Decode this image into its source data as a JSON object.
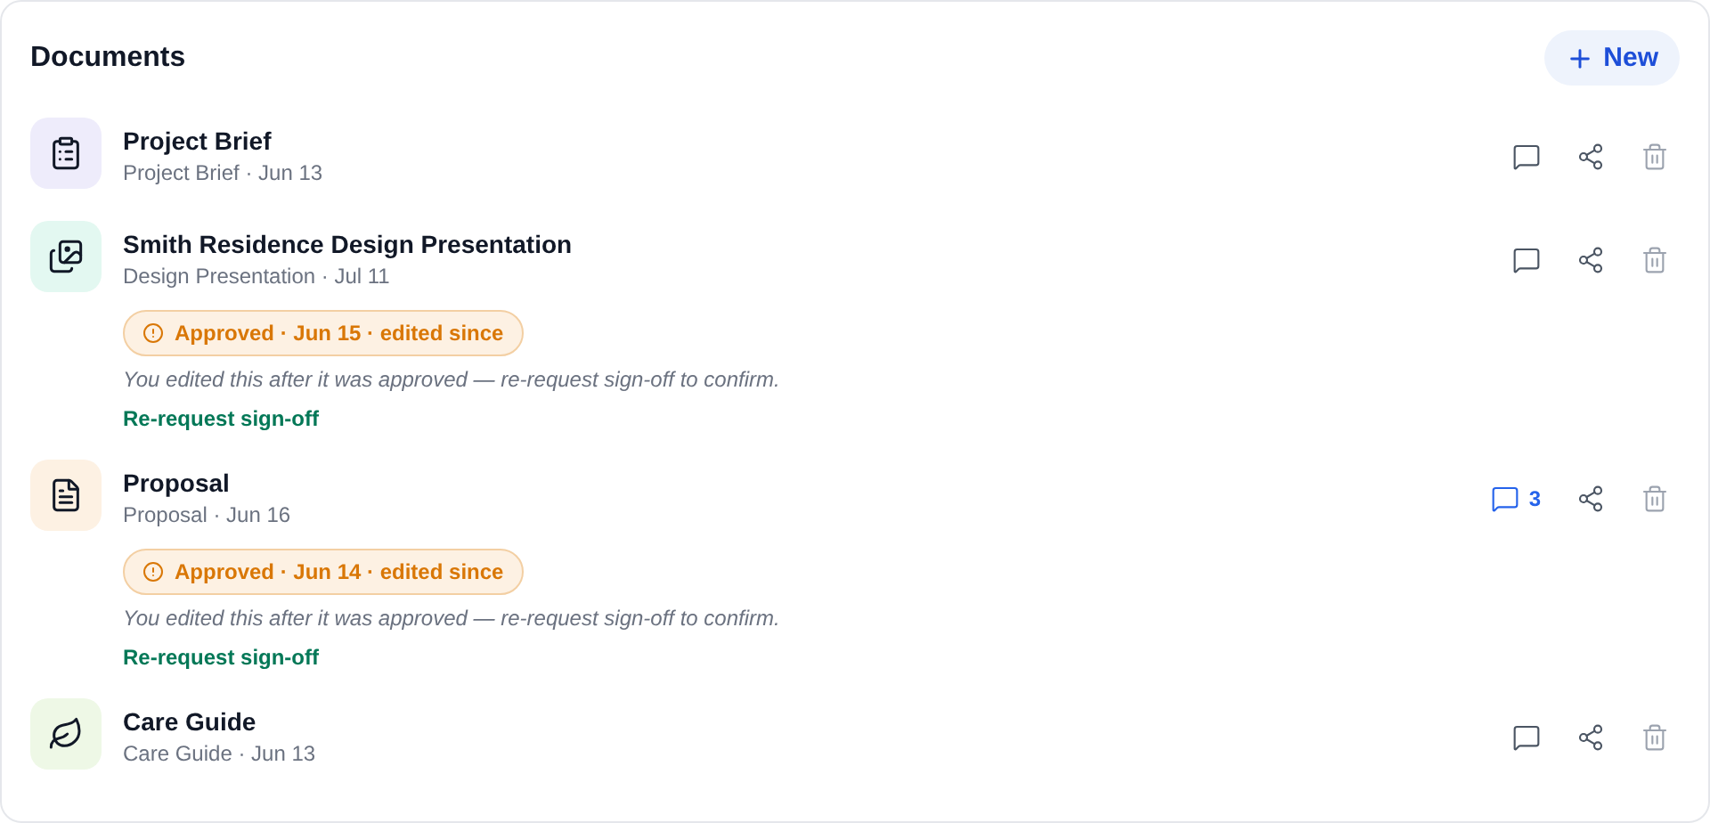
{
  "title": "Documents",
  "new_button": "New",
  "documents": [
    {
      "kind": "clipboard",
      "name": "Project Brief",
      "meta": "Project Brief · Jun 13"
    },
    {
      "kind": "image",
      "name": "Smith Residence Design Presentation",
      "meta": "Design Presentation · Jul 11",
      "approval": {
        "badge": "Approved · Jun 15 · edited since",
        "note": "You edited this after it was approved — re-request sign-off to confirm.",
        "action": "Re-request sign-off"
      }
    },
    {
      "kind": "file",
      "name": "Proposal",
      "meta": "Proposal · Jun 16",
      "comments": "3",
      "approval": {
        "badge": "Approved · Jun 14 · edited since",
        "note": "You edited this after it was approved — re-request sign-off to confirm.",
        "action": "Re-request sign-off"
      }
    },
    {
      "kind": "leaf",
      "name": "Care Guide",
      "meta": "Care Guide · Jun 13"
    }
  ]
}
